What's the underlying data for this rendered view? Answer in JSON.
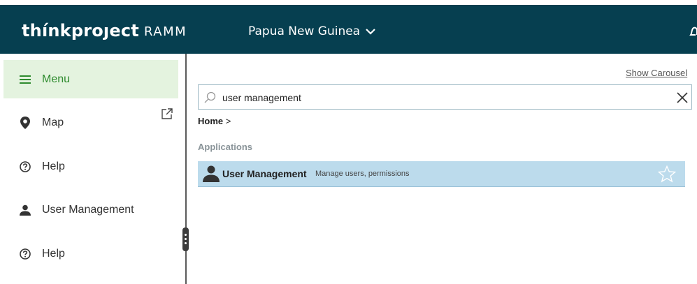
{
  "header": {
    "logo": "thínkproȷect",
    "logo_sub": "RAMM",
    "region": "Papua New Guinea"
  },
  "sidebar": {
    "menu_label": "Menu",
    "items": [
      {
        "label": "Map",
        "icon": "map-pin-icon"
      },
      {
        "label": "Help",
        "icon": "help-circle-icon"
      },
      {
        "label": "User Management",
        "icon": "user-icon"
      },
      {
        "label": "Help",
        "icon": "help-circle-icon"
      }
    ]
  },
  "main": {
    "show_carousel": "Show Carousel",
    "search_value": "user management",
    "breadcrumb_home": "Home",
    "breadcrumb_sep": ">",
    "section_title": "Applications",
    "results": [
      {
        "title": "User Management",
        "description": "Manage users, permissions"
      }
    ]
  },
  "colors": {
    "header_bg": "#063f50",
    "menu_active_bg": "#e4f3df",
    "menu_active_text": "#2e8b2e",
    "result_highlight": "#bcdbec"
  }
}
